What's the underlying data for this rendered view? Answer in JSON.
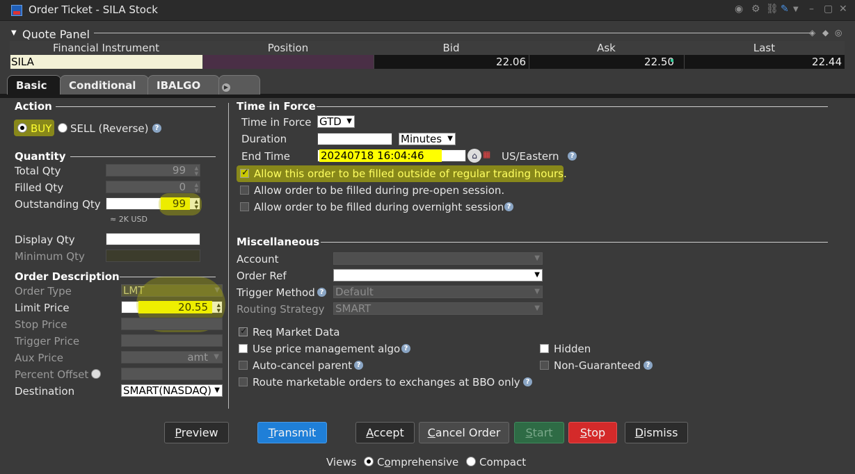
{
  "window": {
    "title": "Order Ticket - SILA Stock"
  },
  "quote_panel": {
    "label": "Quote Panel",
    "headers": [
      "Financial Instrument",
      "Position",
      "Bid",
      "Ask",
      "Last"
    ],
    "symbol": "SILA",
    "bid": "22.06",
    "ask": "22.50",
    "last": "22.44"
  },
  "tabs": [
    "Basic",
    "Conditional",
    "IBALGO"
  ],
  "action": {
    "title": "Action",
    "buy": "BUY",
    "sell": "SELL (Reverse)"
  },
  "quantity": {
    "title": "Quantity",
    "total_label": "Total Qty",
    "total": "99",
    "filled_label": "Filled Qty",
    "filled": "0",
    "outstanding_label": "Outstanding Qty",
    "outstanding": "99",
    "approx": "≈ 2K USD",
    "display_label": "Display Qty",
    "minimum_label": "Minimum Qty"
  },
  "order_description": {
    "title": "Order Description",
    "order_type_label": "Order Type",
    "order_type": "LMT",
    "limit_price_label": "Limit Price",
    "limit_price": "20.55",
    "stop_price_label": "Stop Price",
    "trigger_price_label": "Trigger Price",
    "aux_price_label": "Aux Price",
    "aux_price": "amt",
    "percent_offset_label": "Percent Offset",
    "destination_label": "Destination",
    "destination": "SMART(NASDAQ)"
  },
  "time_in_force": {
    "title": "Time in Force",
    "tif_label": "Time in Force",
    "tif": "GTD",
    "duration_label": "Duration",
    "duration_unit": "Minutes",
    "end_time_label": "End Time",
    "end_time": "20240718 16:04:46",
    "timezone": "US/Eastern",
    "opt_outside_rth": "Allow this order to be filled outside of regular trading hours.",
    "opt_preopen": "Allow order to be filled during pre-open session.",
    "opt_overnight": "Allow order to be filled during overnight session"
  },
  "misc": {
    "title": "Miscellaneous",
    "account_label": "Account",
    "order_ref_label": "Order Ref",
    "trigger_method_label": "Trigger Method",
    "trigger_method": "Default",
    "routing_label": "Routing Strategy",
    "routing": "SMART",
    "req_market_data": "Req Market Data",
    "price_mgmt": "Use price management algo",
    "auto_cancel": "Auto-cancel parent",
    "route_bbo": "Route marketable orders to exchanges at BBO only",
    "hidden": "Hidden",
    "non_guaranteed": "Non-Guaranteed"
  },
  "buttons": {
    "preview_u": "P",
    "preview_rest": "review",
    "transmit_u": "T",
    "transmit_rest": "ransmit",
    "accept_u": "A",
    "accept_rest": "ccept",
    "cancel_u": "C",
    "cancel_rest": "ancel Order",
    "start_u": "S",
    "start_rest": "tart",
    "stop_u": "S",
    "stop_rest": "top",
    "dismiss_u": "D",
    "dismiss_rest": "ismiss"
  },
  "views": {
    "label": "Views",
    "comp_pre": "C",
    "comp_u": "o",
    "comp_rest": "mprehensive",
    "compact": "Compact"
  },
  "colors": {
    "transmit": "#1f7fd8",
    "stop": "#d42a2a",
    "start": "#2e6b45",
    "highlight": "#ffff00"
  }
}
